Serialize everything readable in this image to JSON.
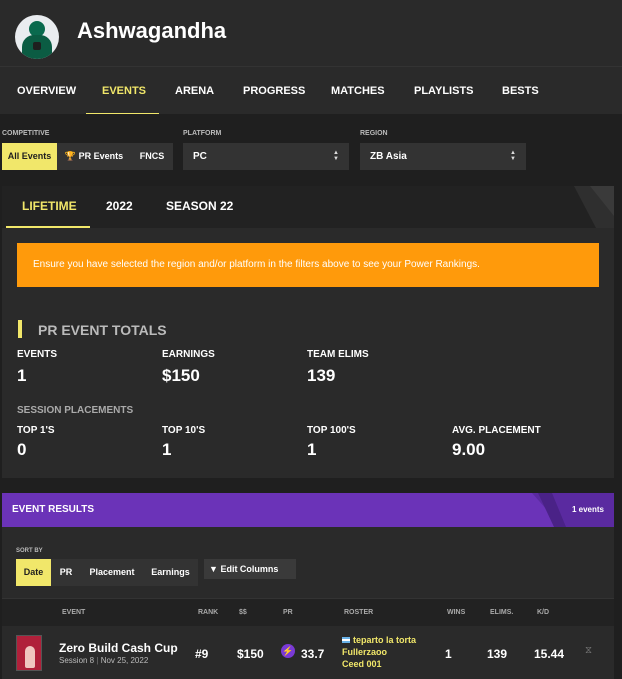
{
  "profile": {
    "username": "Ashwagandha",
    "avatar_icon": "avatar-icon"
  },
  "nav": {
    "tabs": [
      "OVERVIEW",
      "EVENTS",
      "ARENA",
      "PROGRESS",
      "MATCHES",
      "PLAYLISTS",
      "BESTS"
    ],
    "active": "EVENTS"
  },
  "filters": {
    "competitive_label": "COMPETITIVE",
    "competitive_options": [
      "All Events",
      "PR Events",
      "FNCS"
    ],
    "competitive_selected": "All Events",
    "platform_label": "PLATFORM",
    "platform_value": "PC",
    "region_label": "REGION",
    "region_value": "ZB Asia"
  },
  "lifetime": {
    "tabs": [
      "LIFETIME",
      "2022",
      "SEASON 22"
    ],
    "active_tab": "LIFETIME",
    "banner": "Ensure you have selected the region and/or platform in the filters above to see your Power Rankings.",
    "banner_color": "#ff9a0b",
    "section_title": "PR EVENT TOTALS",
    "events_label": "EVENTS",
    "events_value": "1",
    "earnings_label": "EARNINGS",
    "earnings_value": "$150",
    "team_elims_label": "TEAM ELIMS",
    "team_elims_value": "139",
    "session_placements_label": "SESSION PLACEMENTS",
    "top1_label": "TOP 1'S",
    "top1_value": "0",
    "top10_label": "TOP 10'S",
    "top10_value": "1",
    "top100_label": "TOP 100'S",
    "top100_value": "1",
    "avg_label": "AVG. PLACEMENT",
    "avg_value": "9.00"
  },
  "results": {
    "title": "EVENT RESULTS",
    "count": "1 events",
    "header_color": "#6b33b8",
    "sort_label": "SORT BY",
    "sort_options": [
      "Date",
      "PR",
      "Placement",
      "Earnings"
    ],
    "sort_selected": "Date",
    "edit_columns": "Edit Columns",
    "columns": [
      "EVENT",
      "RANK",
      "$$",
      "PR",
      "ROSTER",
      "WINS",
      "ELIMS.",
      "K/D"
    ],
    "rows": [
      {
        "event": "Zero Build Cash Cup",
        "session": "Session 8",
        "date": "Nov 25, 2022",
        "rank": "#9",
        "money": "$150",
        "pr": "33.7",
        "roster": [
          "teparto la torta",
          "Fullerzaoo",
          "Ceed 001"
        ],
        "wins": "1",
        "elims": "139",
        "kd": "15.44"
      }
    ]
  },
  "accent_color": "#f1e76a"
}
